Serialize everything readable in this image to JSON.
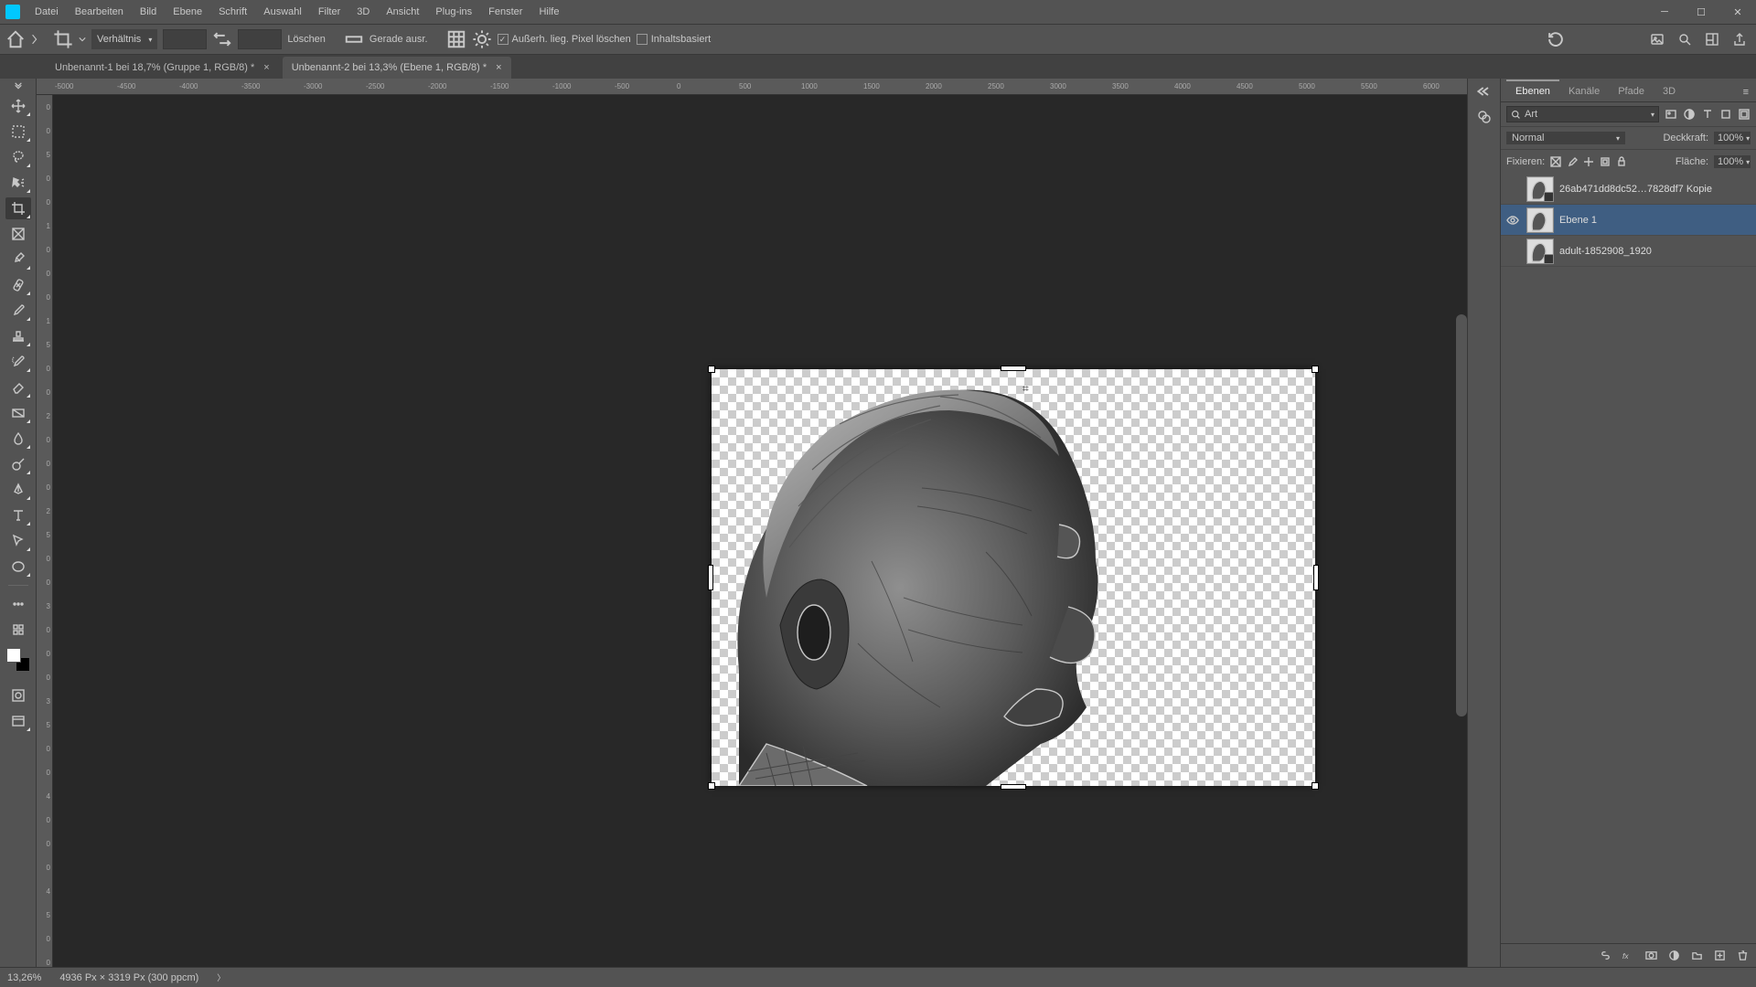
{
  "menu": [
    "Datei",
    "Bearbeiten",
    "Bild",
    "Ebene",
    "Schrift",
    "Auswahl",
    "Filter",
    "3D",
    "Ansicht",
    "Plug-ins",
    "Fenster",
    "Hilfe"
  ],
  "options": {
    "ratio_label": "Verhältnis",
    "clear": "Löschen",
    "straighten": "Gerade ausr.",
    "delete_cropped": "Außerh. lieg. Pixel löschen",
    "content_aware": "Inhaltsbasiert"
  },
  "tabs": [
    {
      "label": "Unbenannt-1 bei 18,7% (Gruppe 1, RGB/8) *",
      "active": false
    },
    {
      "label": "Unbenannt-2 bei 13,3% (Ebene 1, RGB/8) *",
      "active": true
    }
  ],
  "hruler": [
    "-5000",
    "-4500",
    "-4000",
    "-3500",
    "-3000",
    "-2500",
    "-2000",
    "-1500",
    "-1000",
    "-500",
    "0",
    "500",
    "1000",
    "1500",
    "2000",
    "2500",
    "3000",
    "3500",
    "4000",
    "4500",
    "5000",
    "5500",
    "6000"
  ],
  "vruler_small": [
    "0",
    "0",
    "5",
    "0",
    "0",
    "1",
    "0",
    "0",
    "0",
    "1",
    "5",
    "0",
    "0",
    "2",
    "0",
    "0",
    "0",
    "2",
    "5",
    "0",
    "0",
    "3",
    "0",
    "0",
    "0",
    "3",
    "5",
    "0",
    "0",
    "4",
    "0",
    "0",
    "0",
    "4",
    "5",
    "0",
    "0"
  ],
  "panel_tabs": [
    "Ebenen",
    "Kanäle",
    "Pfade",
    "3D"
  ],
  "panel": {
    "search_placeholder": "Art",
    "blend_mode": "Normal",
    "opacity_label": "Deckkraft:",
    "opacity_value": "100%",
    "lock_label": "Fixieren:",
    "fill_label": "Fläche:",
    "fill_value": "100%"
  },
  "layers": [
    {
      "name": "26ab471dd8dc52…7828df7 Kopie",
      "visible": false,
      "smart": true,
      "selected": false
    },
    {
      "name": "Ebene 1",
      "visible": true,
      "smart": false,
      "selected": true
    },
    {
      "name": "adult-1852908_1920",
      "visible": false,
      "smart": true,
      "selected": false
    }
  ],
  "status": {
    "zoom": "13,26%",
    "doc_info": "4936 Px × 3319 Px (300 ppcm)"
  }
}
